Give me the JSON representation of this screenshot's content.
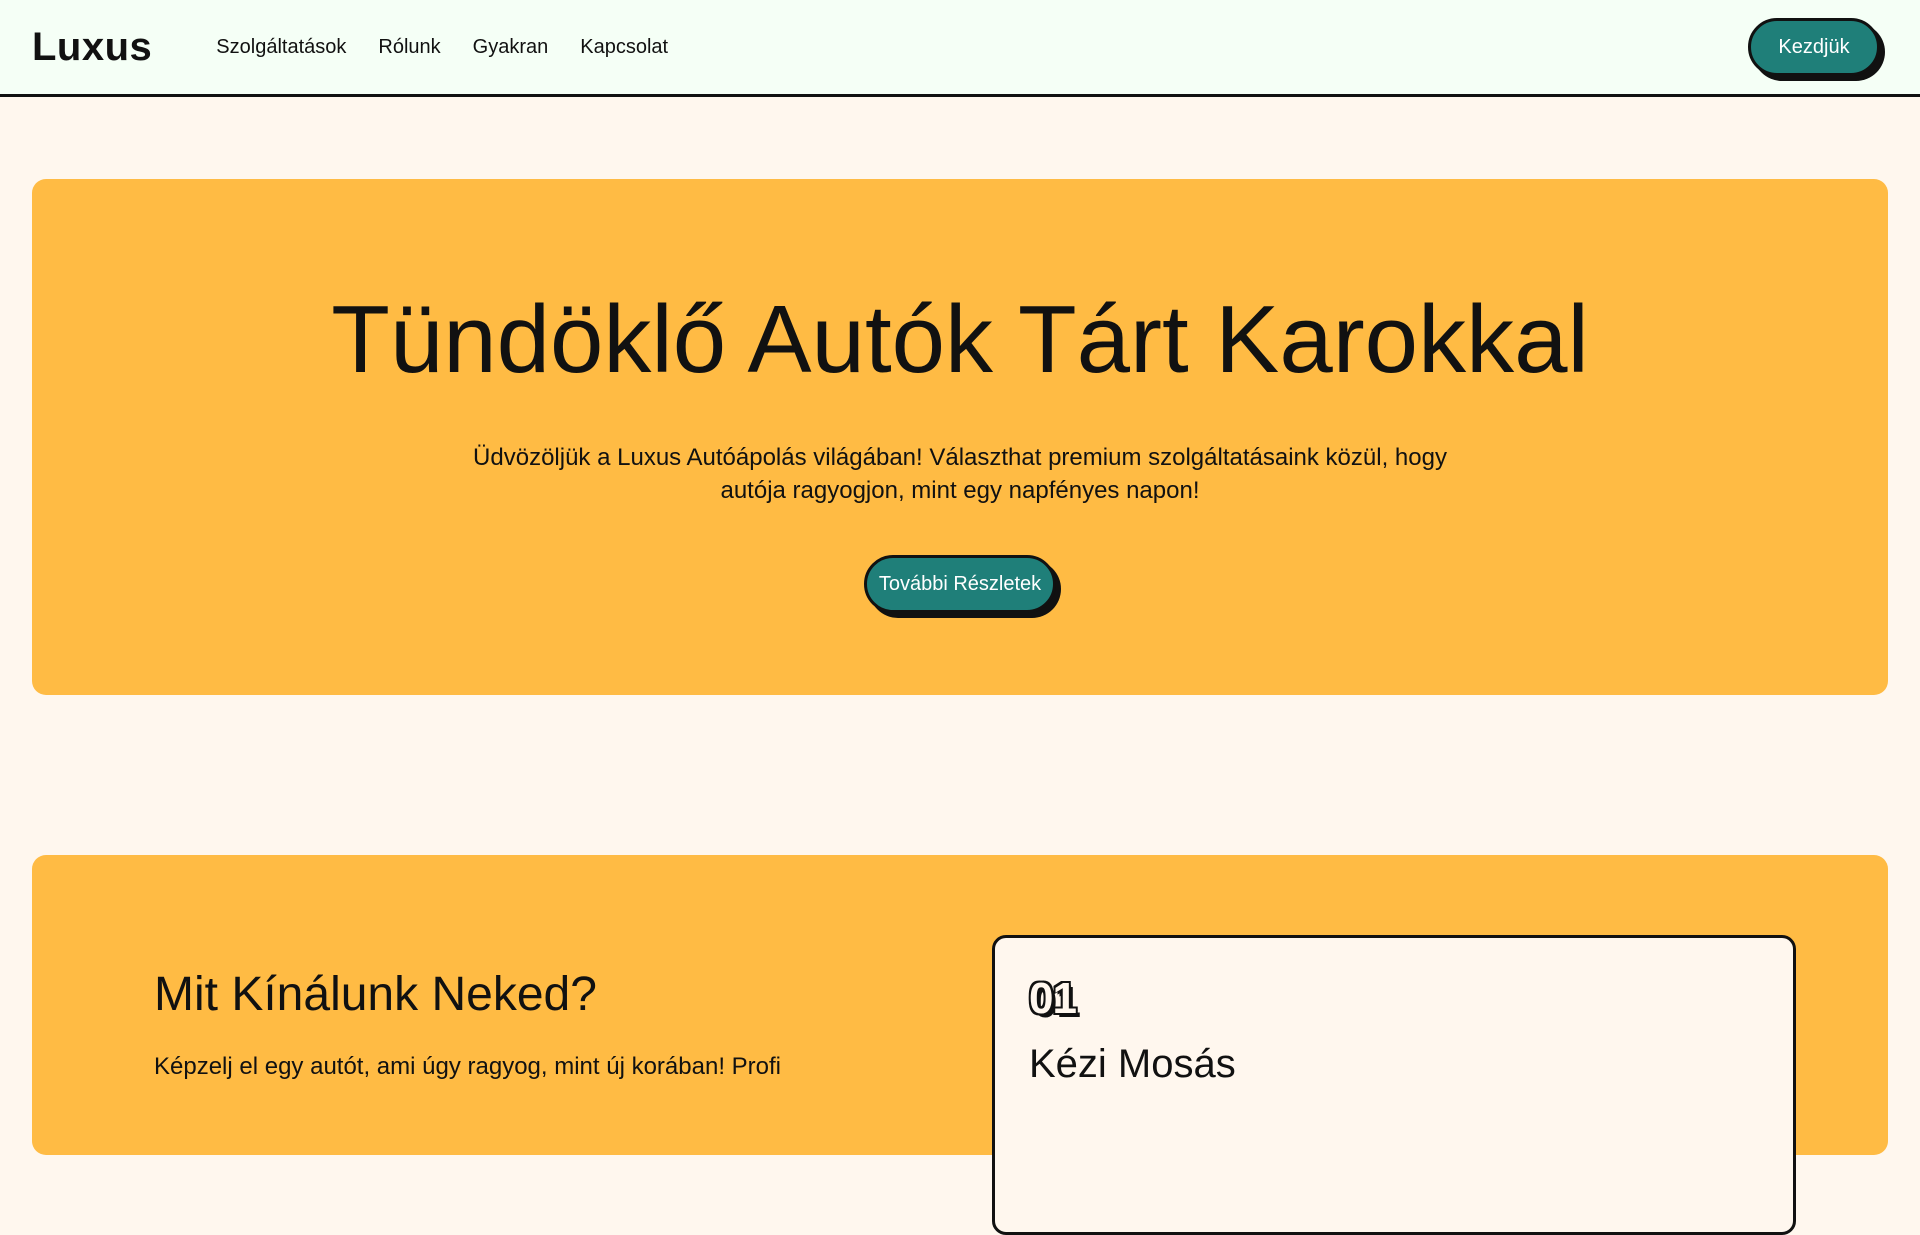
{
  "header": {
    "logo": "Luxus",
    "nav": [
      "Szolgáltatások",
      "Rólunk",
      "Gyakran",
      "Kapcsolat"
    ],
    "cta_label": "Kezdjük"
  },
  "hero": {
    "title": "Tündöklő Autók Tárt Karokkal",
    "description": "Üdvözöljük a Luxus Autóápolás világában! Választhat premium szolgáltatásaink közül, hogy autója ragyogjon, mint egy napfényes napon!",
    "button_label": "További Részletek"
  },
  "services": {
    "title": "Mit Kínálunk Neked?",
    "lead": "Képzelj el egy autót, ami úgy ragyog, mint új korában! Profi",
    "cards": [
      {
        "number": "01",
        "title": "Kézi Mosás"
      }
    ]
  },
  "colors": {
    "accent": "#1f7f79",
    "section_bg": "#ffbb44",
    "page_bg": "#fff7ee",
    "header_bg": "#f5fff6"
  }
}
